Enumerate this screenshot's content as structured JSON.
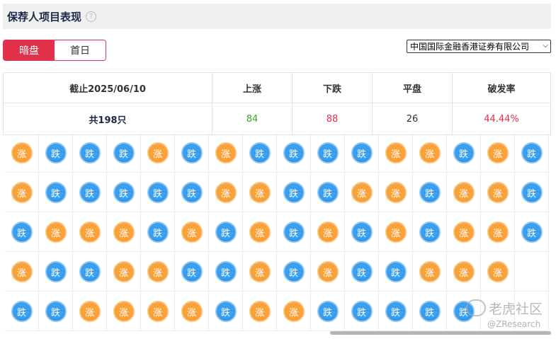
{
  "header": {
    "title": "保荐人项目表现",
    "help_icon": "?"
  },
  "tabs": [
    {
      "label": "暗盘",
      "active": true
    },
    {
      "label": "首日",
      "active": false
    }
  ],
  "broker_select": {
    "value": "中国国际金融香港证券有限公司"
  },
  "summary": {
    "headers": [
      "截止2025/06/10",
      "上涨",
      "下跌",
      "平盘",
      "破发率"
    ],
    "total": "共198只",
    "up": "84",
    "down": "88",
    "flat": "26",
    "break_rate": "44.44%"
  },
  "colors": {
    "up": "#f7a33d",
    "down": "#3b9ff0",
    "accent": "#e0304a"
  },
  "grid": {
    "up_label": "涨",
    "down_label": "跌",
    "rows": [
      [
        "up",
        "down",
        "down",
        "down",
        "up",
        "down",
        "up",
        "down",
        "down",
        "down",
        "down",
        "up",
        "up",
        "down",
        "up",
        "down"
      ],
      [
        "up",
        "down",
        "down",
        "down",
        "down",
        "down",
        "up",
        "up",
        "down",
        "down",
        "up",
        "up",
        "down",
        "up",
        "up",
        "down"
      ],
      [
        "down",
        "up",
        "up",
        "up",
        "down",
        "up",
        "down",
        "up",
        "down",
        "up",
        "down",
        "up",
        "down",
        "up",
        "up",
        "down"
      ],
      [
        "up",
        "down",
        "down",
        "up",
        "up",
        "down",
        "down",
        "up",
        "down",
        "up",
        "down",
        "down",
        "up",
        "up",
        "up"
      ],
      [
        "down",
        "down",
        "up",
        "up",
        "up",
        "up",
        "down",
        "up",
        "up",
        "down",
        "down",
        "down",
        "down",
        "down"
      ]
    ]
  },
  "watermark": {
    "brand": "老虎社区",
    "handle": "@ZResearch"
  }
}
